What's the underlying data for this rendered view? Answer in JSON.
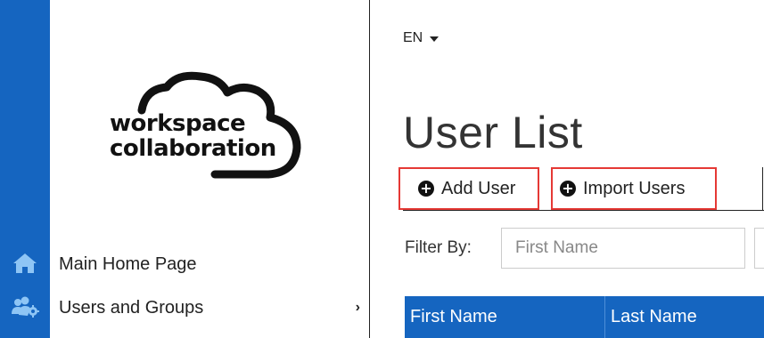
{
  "rail": {
    "icons": [
      "home-icon",
      "users-gear-icon"
    ]
  },
  "sidebar": {
    "logo": {
      "line1": "workspace",
      "line2": "collaboration"
    },
    "items": [
      {
        "label": "Main Home Page",
        "icon": "home-icon",
        "has_submenu": false
      },
      {
        "label": "Users and Groups",
        "icon": "users-gear-icon",
        "has_submenu": true
      }
    ],
    "submenu_chevron": "›"
  },
  "header": {
    "language": "EN"
  },
  "main": {
    "title": "User List",
    "actions": {
      "add_user_label": "Add User",
      "import_users_label": "Import Users",
      "plus_glyph": "+"
    },
    "filter": {
      "label": "Filter By:",
      "first_name_placeholder": "First Name",
      "first_name_value": ""
    },
    "table": {
      "columns": [
        "First Name",
        "Last Name"
      ]
    }
  },
  "colors": {
    "primary_blue": "#1565c0",
    "highlight_red": "#e53935"
  }
}
